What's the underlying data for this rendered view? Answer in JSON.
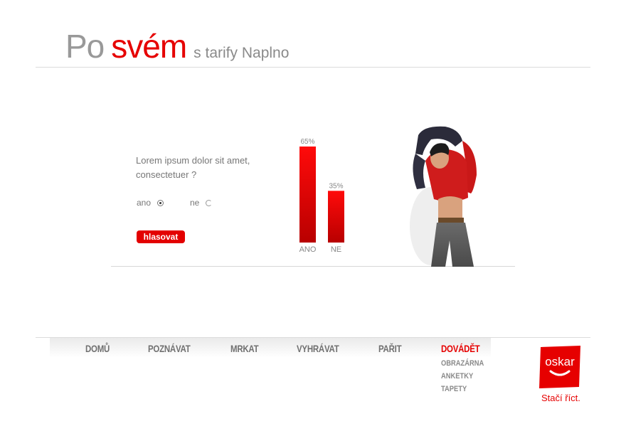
{
  "header": {
    "part1": "Po",
    "part2": "svém",
    "part3": "s tarify Naplno"
  },
  "poll": {
    "question": "Lorem ipsum dolor sit amet, consectetuer ?",
    "options": [
      {
        "label": "ano",
        "selected": true
      },
      {
        "label": "ne",
        "selected": false
      }
    ],
    "vote_label": "hlasovat"
  },
  "chart_data": {
    "type": "bar",
    "categories": [
      "ANO",
      "NE"
    ],
    "values": [
      65,
      35
    ],
    "value_labels": [
      "65%",
      "35%"
    ],
    "ylim": [
      0,
      65
    ],
    "colors": [
      "#e60000",
      "#e60000"
    ]
  },
  "nav": {
    "items": [
      "DOMŮ",
      "POZNÁVAT",
      "MRKAT",
      "VYHRÁVAT",
      "PAŘIT",
      "DOVÁDĚT"
    ],
    "active": "DOVÁDĚT",
    "sub_items": [
      "OBRAZÁRNA",
      "ANKETKY",
      "TAPETY"
    ]
  },
  "brand": {
    "logo_text": "oskar",
    "tagline": "Stačí říct.",
    "accent": "#e60000"
  }
}
